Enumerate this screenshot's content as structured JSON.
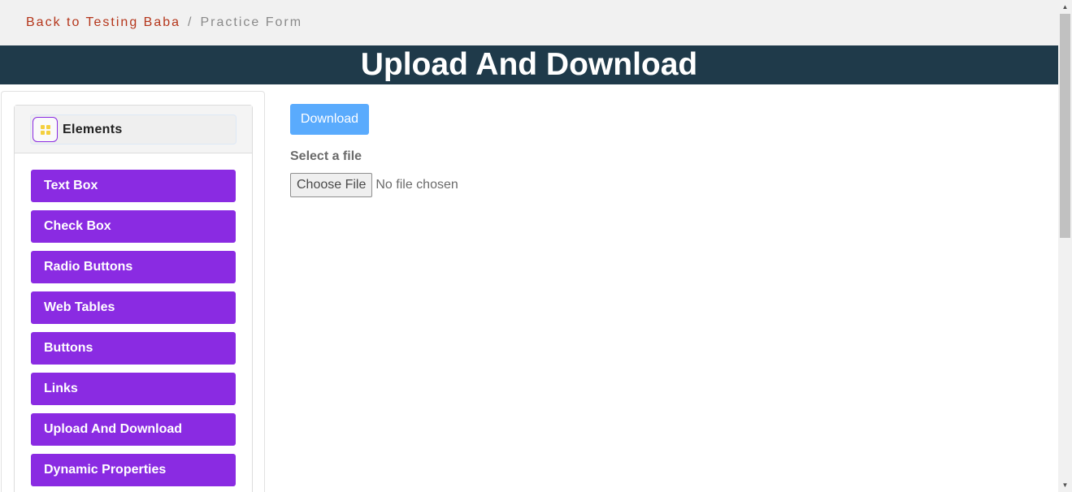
{
  "breadcrumb": {
    "link_label": "Back to Testing Baba",
    "separator": "/",
    "current": "Practice Form"
  },
  "banner": {
    "title": "Upload And Download"
  },
  "sidebar": {
    "section_title": "Elements",
    "items": [
      {
        "label": "Text Box"
      },
      {
        "label": "Check Box"
      },
      {
        "label": "Radio Buttons"
      },
      {
        "label": "Web Tables"
      },
      {
        "label": "Buttons"
      },
      {
        "label": "Links"
      },
      {
        "label": "Upload And Download"
      },
      {
        "label": "Dynamic Properties"
      }
    ]
  },
  "main": {
    "download_label": "Download",
    "file_label": "Select a file",
    "choose_file_label": "Choose File",
    "file_status": "No file chosen"
  },
  "scrollbar": {
    "up_icon": "▲",
    "down_icon": "▼"
  },
  "colors": {
    "accent_purple": "#8a2be2",
    "banner_bg": "#1f3a4a",
    "link_red": "#b5361b",
    "download_blue": "#5aabfd"
  }
}
